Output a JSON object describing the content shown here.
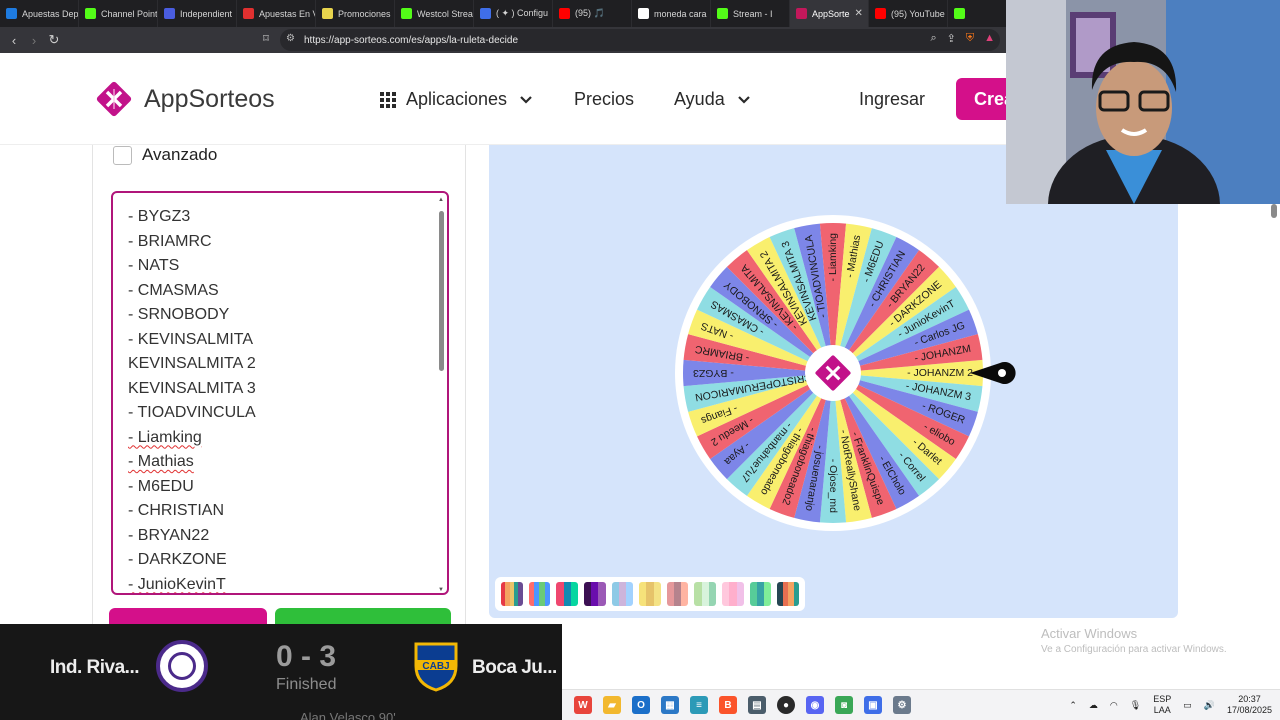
{
  "browser": {
    "tabs": [
      {
        "label": "Apuestas Dep",
        "color": "#1e7be0"
      },
      {
        "label": "Channel Point",
        "color": "#53fc18"
      },
      {
        "label": "Independient",
        "color": "#4a5de0"
      },
      {
        "label": "Apuestas En V",
        "color": "#e03030"
      },
      {
        "label": "Promociones",
        "color": "#e8d44d"
      },
      {
        "label": "Westcol Strea",
        "color": "#53fc18"
      },
      {
        "label": "( ✦ ) Configu",
        "color": "#3f6ee8"
      },
      {
        "label": "(95) 🎵",
        "color": "#ff0000"
      },
      {
        "label": "moneda cara",
        "color": "#ffffff"
      },
      {
        "label": "Stream - I",
        "color": "#53fc18"
      },
      {
        "label": "AppSorte",
        "color": "#c2185b",
        "active": true,
        "close": "✕"
      },
      {
        "label": "(95) YouTube",
        "color": "#ff0000"
      },
      {
        "label": "",
        "color": "#53fc18"
      }
    ],
    "url": "https://app-sorteos.com/es/apps/la-ruleta-decide"
  },
  "header": {
    "logo_prefix": "App",
    "logo_suffix": "Sorteos",
    "nav_apps": "Aplicaciones",
    "nav_prices": "Precios",
    "nav_help": "Ayuda",
    "login": "Ingresar",
    "create": "Crear"
  },
  "panel": {
    "advanced_label": "Avanzado",
    "names": [
      "- BYGZ3",
      "- BRIAMRC",
      "- NATS",
      "- CMASMAS",
      "- SRNOBODY",
      "- KEVINSALMITA",
      "KEVINSALMITA 2",
      "KEVINSALMITA 3",
      "- TIOADVINCULA",
      "- Liamking",
      "- Mathias",
      "- M6EDU",
      "- CHRISTIAN",
      "- BRYAN22",
      "- DARKZONE",
      "- JunioKevinT"
    ]
  },
  "wheel": {
    "segments": [
      "- JOHANZM 2",
      "- JOHANZM 3",
      "- ROGER",
      "- eliobo",
      "- Darlet",
      "- Correl",
      "- ElCholo",
      "- FranklinQuispe",
      "- NotReallyShane",
      "- Ojose_md",
      "- josuenaranjo",
      "- thiagoboneado2",
      "- thiagoboneado",
      "- manbahue7u7",
      "- Ayaa",
      "- Meedu 2",
      "- Fiangs",
      "- CRISTOPERUMARICON",
      "- BYGZ3",
      "- BRIAMRC",
      "- NATS",
      "- CMASMAS",
      "- SRNOBODY",
      "- KEVINSALMITA",
      "KEVINSALMITA 2",
      "KEVINSALMITA 3",
      "- TIOADVINCULA",
      "- Liamking",
      "- Mathias",
      "- M6EDU",
      "- CHRISTIAN",
      "- BRYAN22",
      "- DARKZONE",
      "- JunioKevinT",
      "- Carlos JG",
      "- JOHANZM"
    ],
    "colors": [
      "#f9ef6e",
      "#8fdde3",
      "#7d86e8",
      "#f06470"
    ],
    "center_color": "#c2128a"
  },
  "palettes": [
    [
      "#e63946",
      "#f4a261",
      "#e9c46a",
      "#2a9d8f",
      "#6a4c93"
    ],
    [
      "#ff6b6b",
      "#4d96ff",
      "#6bcb77",
      "#4d96ff"
    ],
    [
      "#ef476f",
      "#118ab2",
      "#06d6a0"
    ],
    [
      "#3c1053",
      "#6a0dad",
      "#9b59b6"
    ],
    [
      "#8ecae6",
      "#cdb4db",
      "#a2d2ff"
    ],
    [
      "#f6e27a",
      "#e6c36a",
      "#f4e285"
    ],
    [
      "#e5989b",
      "#b5838d",
      "#ffb4a2"
    ],
    [
      "#b8e0a5",
      "#d8f3dc",
      "#95d5b2"
    ],
    [
      "#ffc8dd",
      "#ffafcc",
      "#f1c0e8"
    ],
    [
      "#57cc99",
      "#38a3a5",
      "#80ed99"
    ],
    [
      "#264653",
      "#e76f51",
      "#f4a261",
      "#2a9d8f"
    ]
  ],
  "score": {
    "home": "Ind. Riva...",
    "away": "Boca Ju...",
    "result": "0 - 3",
    "status": "Finished",
    "extra": "Alan Velasco 90'",
    "home_color": "#4b2a8a",
    "away_color": "#0b3d91"
  },
  "activate": {
    "title": "Activar Windows",
    "subtitle": "Ve a Configuración para activar Windows."
  },
  "taskbar": {
    "lang_top": "ESP",
    "lang_bottom": "LAA",
    "time": "20:37",
    "date": "17/08/2025"
  }
}
